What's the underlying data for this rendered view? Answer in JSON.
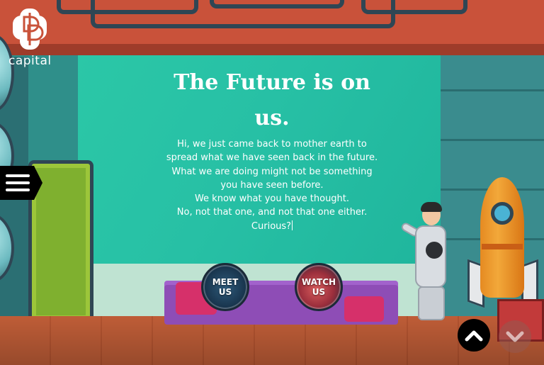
{
  "brand": {
    "name": "capital",
    "logo_icon": "capital-logo-icon"
  },
  "nav": {
    "menu_icon": "hamburger-menu-icon"
  },
  "hero": {
    "headline_line1": "The Future is on",
    "headline_line2": "us.",
    "body_lines": [
      "Hi, we just came back to mother earth to",
      "spread what we have seen back in the future.",
      "What we are doing might not be something",
      "you have seen before.",
      "We know what you have thought.",
      "No, not that one, and not that one either.",
      "Curious?"
    ]
  },
  "actions": {
    "meet_us_line1": "MEET",
    "meet_us_line2": "US",
    "watch_us_line1": "WATCH",
    "watch_us_line2": "US"
  },
  "scroll": {
    "up_icon": "chevron-up-icon",
    "down_icon": "chevron-down-icon"
  },
  "colors": {
    "screen_teal": "#27c0a5",
    "ceiling_red": "#c9523a",
    "stage_purple": "#8e4db6",
    "accent_pink": "#d6306a",
    "scroll_up_bg": "#000000"
  }
}
